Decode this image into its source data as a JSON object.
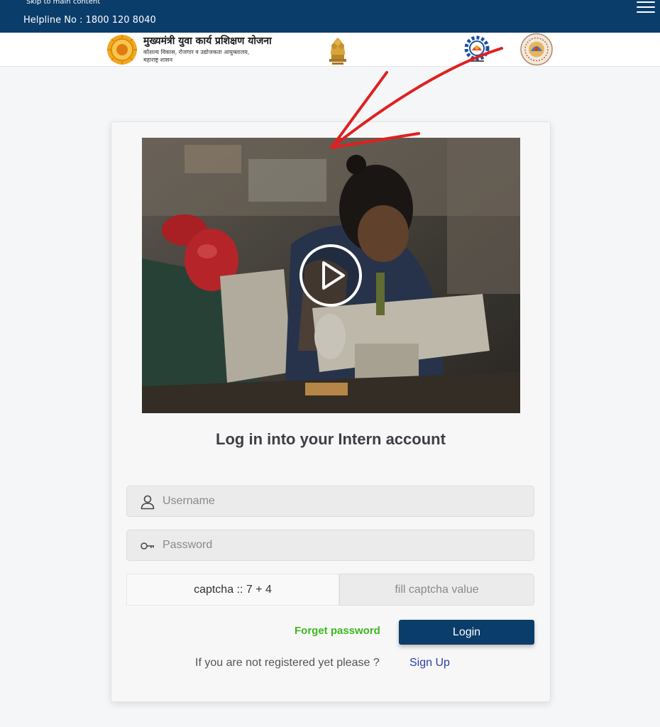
{
  "header": {
    "skip_link": "Skip to main content",
    "helpline": "Helpline No : 1800 120 8040",
    "menu_icon": "hamburger-icon"
  },
  "logos": {
    "scheme_title": "मुख्यमंत्री युवा कार्य प्रशिक्षण योजना",
    "scheme_sub_line1": "कौशल्य विकास, रोजगार व उद्योजकता आयुक्तालय,",
    "scheme_sub_line2": "महाराष्ट्र शासन"
  },
  "video": {
    "play_icon": "play-icon"
  },
  "login": {
    "title": "Log in into your Intern account",
    "username_placeholder": "Username",
    "password_placeholder": "Password",
    "captcha_label": "captcha :: 7 + 4",
    "captcha_placeholder": "fill captcha value",
    "forget_password": "Forget password",
    "login_button": "Login",
    "register_prompt": "If you are not registered yet please ?",
    "signup_link": "Sign Up"
  },
  "colors": {
    "header_bg": "#0b3d6b",
    "button_bg": "#0b3d6b",
    "forget_link": "#3cb81f",
    "signup_link": "#2a3fa8",
    "annotation_arrow": "#e02020"
  }
}
